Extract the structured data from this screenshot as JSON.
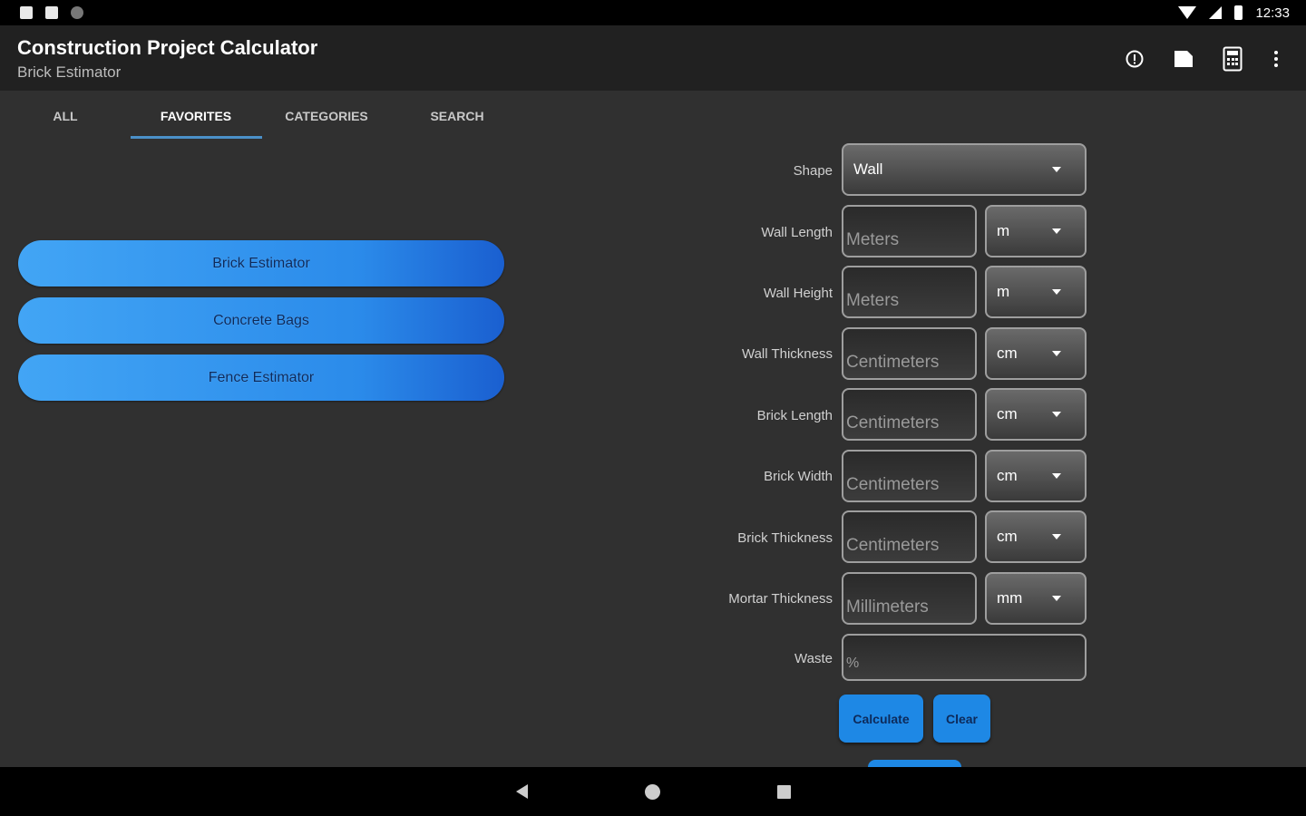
{
  "status_bar": {
    "time": "12:33"
  },
  "app_bar": {
    "title": "Construction Project Calculator",
    "subtitle": "Brick Estimator",
    "icons": [
      "info-icon",
      "save-icon",
      "calculator-icon",
      "more-vert-icon"
    ]
  },
  "tabs": [
    {
      "label": "ALL",
      "active": false
    },
    {
      "label": "FAVORITES",
      "active": true
    },
    {
      "label": "CATEGORIES",
      "active": false
    },
    {
      "label": "SEARCH",
      "active": false
    }
  ],
  "favorites": [
    "Brick Estimator",
    "Concrete Bags",
    "Fence Estimator"
  ],
  "form": {
    "shape": {
      "label": "Shape",
      "value": "Wall"
    },
    "fields": [
      {
        "label": "Wall Length",
        "placeholder": "Meters",
        "unit": "m"
      },
      {
        "label": "Wall Height",
        "placeholder": "Meters",
        "unit": "m"
      },
      {
        "label": "Wall Thickness",
        "placeholder": "Centimeters",
        "unit": "cm"
      },
      {
        "label": "Brick Length",
        "placeholder": "Centimeters",
        "unit": "cm"
      },
      {
        "label": "Brick Width",
        "placeholder": "Centimeters",
        "unit": "cm"
      },
      {
        "label": "Brick Thickness",
        "placeholder": "Centimeters",
        "unit": "cm"
      },
      {
        "label": "Mortar Thickness",
        "placeholder": "Millimeters",
        "unit": "mm"
      }
    ],
    "waste": {
      "label": "Waste",
      "placeholder": "%"
    },
    "calculate_label": "Calculate",
    "clear_label": "Clear"
  },
  "colors": {
    "accent": "#1e88e5",
    "background": "#303030",
    "app_bar": "#212121",
    "tab_indicator": "#4a90c8"
  }
}
